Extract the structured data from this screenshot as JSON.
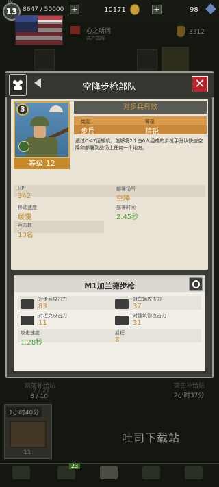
{
  "top_bar": {
    "level_tag": "LV",
    "level": "13",
    "xp": "8647 / 50000",
    "coins": "10171",
    "gems": "98",
    "plus": "+"
  },
  "profile": {
    "alliance_name": "心之所问",
    "alliance_sub": "共产国际",
    "power": "3312"
  },
  "background": {
    "left_slot_label": "网架补给站",
    "left_slot_sub": "(2 / 2)",
    "left_slot_count": "8 / 10",
    "right_slot_label": "突击补给站",
    "right_slot_timer": "2小时37分",
    "timer_card_label": "1小时40分",
    "crate_count": "11",
    "nav_badge": "23"
  },
  "watermark": "吐司下载站",
  "modal": {
    "title": "空降步枪部队",
    "close": "✕",
    "unit": {
      "rank": "3",
      "level_text": "等级 12",
      "counter_banner": "对步兵有效",
      "type_label": "类型",
      "type_value": "步兵",
      "grade_label": "等级",
      "grade_value": "精锐",
      "description": "透过C-47运输机，能够将2个由6人组成的步枪手分队快速空降和部署到战场上任何一个地方。"
    },
    "stats": {
      "hp_label": "HP",
      "hp_value": "342",
      "deploy_label": "部署场所",
      "deploy_value": "空降",
      "speed_label": "移动速度",
      "speed_value": "缓慢",
      "deploy_time_label": "部署时间",
      "deploy_time_value": "2.45秒",
      "troops_label": "兵力数",
      "troops_value": "10名"
    },
    "weapon": {
      "name": "M1加兰德步枪",
      "vs_infantry_label": "对步兵攻击力",
      "vs_infantry_value": "83",
      "vs_vehicle_label": "对车辆攻击力",
      "vs_vehicle_value": "37",
      "vs_tank_label": "对坦克攻击力",
      "vs_tank_value": "11",
      "vs_building_label": "对建筑物攻击力",
      "vs_building_value": "31",
      "attack_speed_label": "攻击速度",
      "attack_speed_value": "1.28秒",
      "range_label": "射程",
      "range_value": "8"
    }
  },
  "colors": {
    "accent_gold": "#c4892c",
    "accent_green": "#45a43a",
    "close_red": "#b8232a",
    "info_orange": "#d99c4e"
  }
}
